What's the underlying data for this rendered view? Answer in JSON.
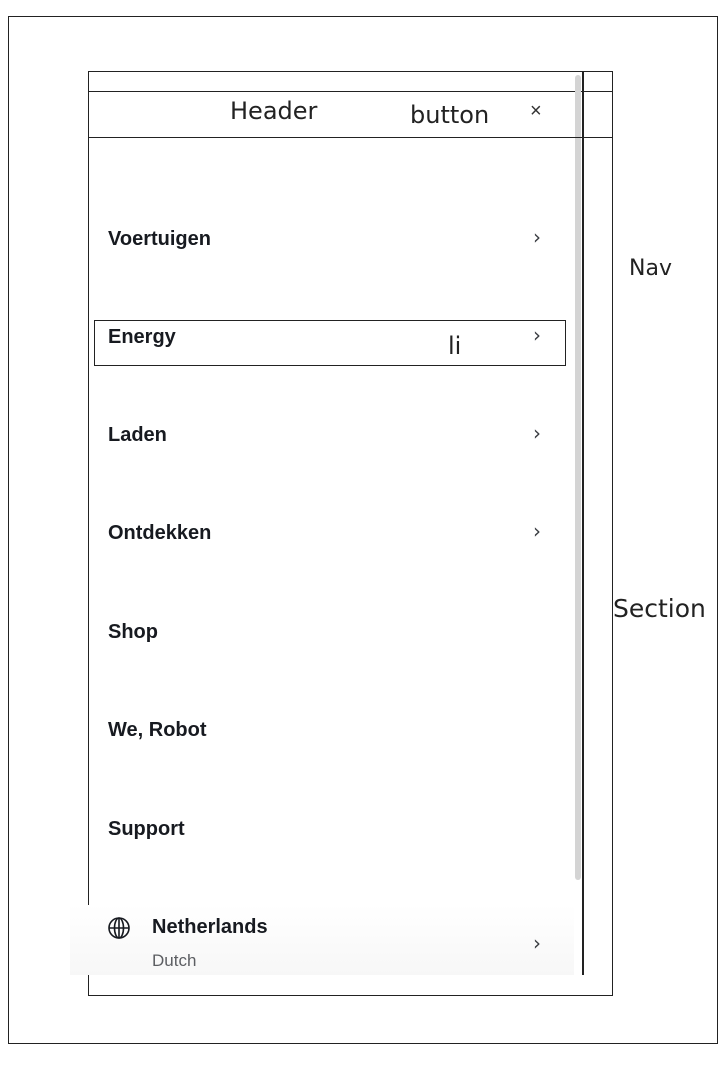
{
  "annotations": {
    "section": "Section",
    "nav": "Nav",
    "header": "Header",
    "button": "button",
    "li": "li"
  },
  "header": {
    "close_icon": "close-icon",
    "close_glyph": "×"
  },
  "menu": {
    "items": [
      {
        "label": "Voertuigen",
        "has_chevron": true
      },
      {
        "label": "Energy",
        "has_chevron": true
      },
      {
        "label": "Laden",
        "has_chevron": true
      },
      {
        "label": "Ontdekken",
        "has_chevron": true
      },
      {
        "label": "Shop",
        "has_chevron": false
      },
      {
        "label": "We, Robot",
        "has_chevron": false
      },
      {
        "label": "Support",
        "has_chevron": false
      }
    ],
    "chevron_glyph": "›"
  },
  "region": {
    "icon": "globe-icon",
    "country": "Netherlands",
    "language": "Dutch",
    "chevron_glyph": "›"
  }
}
